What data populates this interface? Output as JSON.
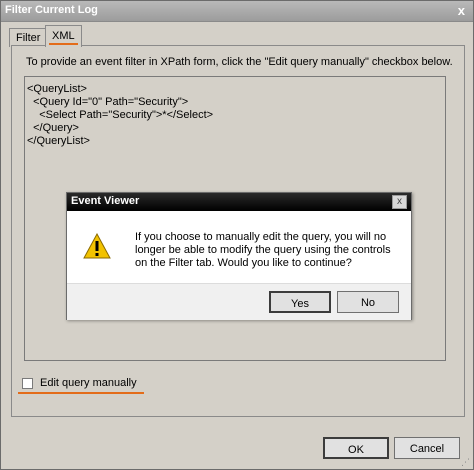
{
  "window": {
    "title": "Filter Current Log",
    "close_glyph": "x"
  },
  "tabs": [
    {
      "label": "Filter",
      "selected": false
    },
    {
      "label": "XML",
      "selected": true
    }
  ],
  "xml_panel": {
    "instruction": "To provide an event filter in XPath form, click the \"Edit query manually\" checkbox below.",
    "query_lines": [
      "<QueryList>",
      "  <Query Id=\"0\" Path=\"Security\">",
      "    <Select Path=\"Security\">*</Select>",
      "  </Query>",
      "</QueryList>"
    ],
    "edit_checkbox": {
      "label": "Edit query manually",
      "checked": false
    }
  },
  "buttons": {
    "ok": "OK",
    "cancel": "Cancel"
  },
  "modal": {
    "title": "Event Viewer",
    "close_glyph": "x",
    "icon": "warning-icon",
    "message": "If you choose to manually edit the query, you will no longer be able to modify the query using the controls on the Filter tab. Would you like to continue?",
    "yes": "Yes",
    "no": "No"
  },
  "colors": {
    "highlight_orange": "#e36c1a",
    "warning_yellow": "#f2c200"
  }
}
